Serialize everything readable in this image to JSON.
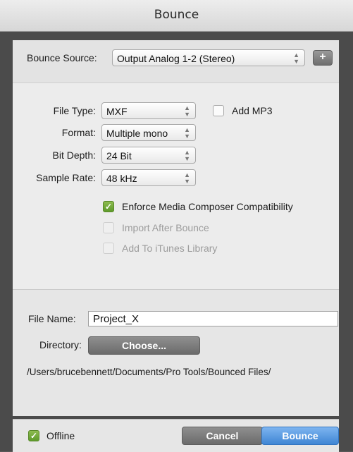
{
  "window": {
    "title": "Bounce"
  },
  "source": {
    "label": "Bounce Source:",
    "value": "Output Analog 1-2 (Stereo)",
    "add_label": "+"
  },
  "settings": {
    "file_type": {
      "label": "File Type:",
      "value": "MXF"
    },
    "add_mp3": {
      "label": "Add MP3",
      "checked": false
    },
    "format": {
      "label": "Format:",
      "value": "Multiple mono"
    },
    "bit_depth": {
      "label": "Bit Depth:",
      "value": "24 Bit"
    },
    "sample_rate": {
      "label": "Sample Rate:",
      "value": "48 kHz"
    },
    "enforce": {
      "label": "Enforce Media Composer Compatibility",
      "checked": true
    },
    "import_after": {
      "label": "Import After Bounce",
      "checked": false,
      "enabled": false
    },
    "itunes": {
      "label": "Add To iTunes Library",
      "checked": false,
      "enabled": false
    }
  },
  "output": {
    "file_name_label": "File Name:",
    "file_name_value": "Project_X",
    "directory_label": "Directory:",
    "choose_label": "Choose...",
    "path": "/Users/brucebennett/Documents/Pro Tools/Bounced Files/"
  },
  "footer": {
    "offline_label": "Offline",
    "offline_checked": true,
    "cancel_label": "Cancel",
    "bounce_label": "Bounce"
  },
  "colors": {
    "accent_blue": "#3f86d4",
    "check_green": "#5e9a2b"
  },
  "icons": {
    "checkmark": "checkmark-icon",
    "dropdown": "dropdown-arrow-icon"
  }
}
